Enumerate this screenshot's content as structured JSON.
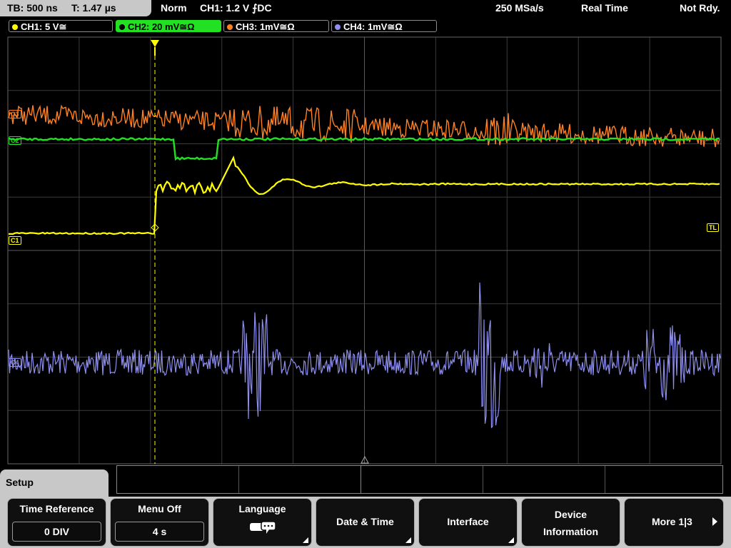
{
  "status": {
    "timebase": "TB: 500 ns",
    "trigger_time": "T: 1.47 µs",
    "mode": "Norm",
    "trigger": "CH1: 1.2 V ⨍DC",
    "sample_rate": "250 MSa/s",
    "acq_mode": "Real Time",
    "state": "Not Rdy."
  },
  "channels": [
    {
      "label": "CH1: 5 V≅",
      "color": "#ffff00"
    },
    {
      "label": "CH2: 20 mV≅Ω",
      "color": "#22e022",
      "active": true
    },
    {
      "label": "CH3: 1mV≅Ω",
      "color": "#ff8020"
    },
    {
      "label": "CH4: 1mV≅Ω",
      "color": "#8f8fef"
    }
  ],
  "markers": {
    "ch3": "C3",
    "ch2": "C2",
    "ch1": "C1",
    "ch4": "C4",
    "trigger_level": "TL",
    "trigger_pos": "T"
  },
  "menu": {
    "title": "Setup",
    "softkeys": [
      {
        "label": "Time Reference",
        "value": "0 DIV"
      },
      {
        "label": "Menu Off",
        "value": "4 s"
      },
      {
        "label": "Language",
        "icon": "speech-bubbles-icon"
      },
      {
        "label": "Date & Time"
      },
      {
        "label": "Interface"
      },
      {
        "label_line1": "Device",
        "label_line2": "Information"
      },
      {
        "label": "More 1|3"
      }
    ]
  }
}
